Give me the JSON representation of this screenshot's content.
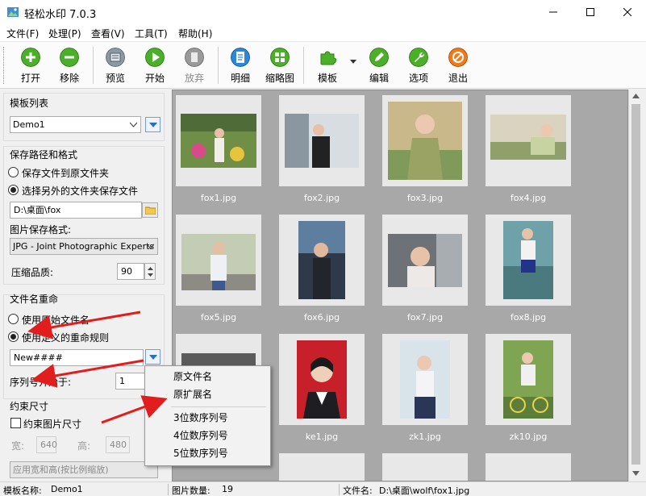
{
  "window": {
    "title": "轻松水印 7.0.3"
  },
  "menu": [
    "文件(F)",
    "处理(P)",
    "查看(V)",
    "工具(T)",
    "帮助(H)"
  ],
  "toolbar": [
    {
      "label": "打开",
      "icon": "plus-icon",
      "color": "#4caf2a"
    },
    {
      "label": "移除",
      "icon": "minus-icon",
      "color": "#4caf2a"
    },
    {
      "label": "预览",
      "icon": "preview-icon",
      "color": "#7a8a99"
    },
    {
      "label": "开始",
      "icon": "play-icon",
      "color": "#4caf2a"
    },
    {
      "label": "放弃",
      "icon": "stop-icon",
      "color": "#8a8a8a",
      "disabled": true
    },
    {
      "label": "明细",
      "icon": "document-icon",
      "color": "#2d87d9"
    },
    {
      "label": "缩略图",
      "icon": "thumbnail-icon",
      "color": "#4caf2a"
    },
    {
      "label": "模板",
      "icon": "puzzle-icon",
      "color": "#4caf2a"
    },
    {
      "label": "编辑",
      "icon": "pencil-icon",
      "color": "#4caf2a"
    },
    {
      "label": "选项",
      "icon": "wrench-icon",
      "color": "#4caf2a"
    },
    {
      "label": "退出",
      "icon": "exit-icon",
      "color": "#f07a1a"
    }
  ],
  "left": {
    "template_header": "模板列表",
    "template_value": "Demo1",
    "save_header": "保存路径和格式",
    "save_opt1": "保存文件到原文件夹",
    "save_opt2": "选择另外的文件夹保存文件",
    "save_path": "D:\\桌面\\fox",
    "format_label": "图片保存格式:",
    "format_value": "JPG - Joint Photographic Experts G",
    "quality_label": "压缩品质:",
    "quality_value": "90",
    "rename_header": "文件名重命",
    "rename_opt1": "使用原始文件名",
    "rename_opt2": "使用定义的重命规则",
    "rename_rule": "New####",
    "seq_label": "序列号开始于:",
    "seq_value": "1",
    "constrain_header": "约束尺寸",
    "constrain_check": "约束图片尺寸",
    "width_label": "宽:",
    "width_value": "640",
    "height_label": "高:",
    "height_value": "480",
    "scale_mode": "应用宽和高(按比例缩放)"
  },
  "gallery": [
    {
      "name": "fox1.jpg"
    },
    {
      "name": "fox2.jpg"
    },
    {
      "name": "fox3.jpg"
    },
    {
      "name": "fox4.jpg"
    },
    {
      "name": "fox5.jpg"
    },
    {
      "name": "fox6.jpg"
    },
    {
      "name": "fox7.jpg"
    },
    {
      "name": "fox8.jpg"
    },
    {
      "name": ""
    },
    {
      "name": "ke1.jpg"
    },
    {
      "name": "zk1.jpg"
    },
    {
      "name": "zk10.jpg"
    }
  ],
  "context_menu": [
    "原文件名",
    "原扩展名",
    "3位数序列号",
    "4位数序列号",
    "5位数序列号"
  ],
  "status": {
    "template_label": "模板名称:",
    "template_value": "Demo1",
    "count_label": "图片数量:",
    "count_value": "19",
    "file_label": "文件名:",
    "file_value": "D:\\桌面\\wolf\\fox1.jpg"
  },
  "colors": {
    "accent_blue": "#2d6ec5",
    "annotation_red": "#e21d1d",
    "gallery_bg": "#a8a8a8"
  }
}
